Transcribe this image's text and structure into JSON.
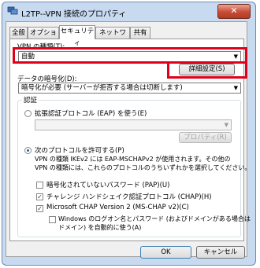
{
  "window": {
    "title": "L2TP--VPN 接続のプロパティ",
    "close_glyph": "✕"
  },
  "tabs": [
    {
      "label": "全般"
    },
    {
      "label": "オプション"
    },
    {
      "label": "セキュリティ"
    },
    {
      "label": "ネットワーク"
    },
    {
      "label": "共有"
    }
  ],
  "vpn_type": {
    "label": "VPN の種類(T):",
    "value": "自動"
  },
  "advanced_button": "詳細設定(S)",
  "encryption": {
    "label": "データの暗号化(D):",
    "value": "暗号化が必要 (サーバーが拒否する場合は切断します)"
  },
  "auth": {
    "group_label": "認証",
    "eap": {
      "label": "拡張認証プロトコル (EAP) を使う(E)",
      "properties_button": "プロパティ(R)"
    },
    "allow": {
      "label": "次のプロトコルを許可する(P)",
      "desc_line1": "VPN の種類 IKEv2 には EAP-MSCHAPv2 が使用されます。その他の",
      "desc_line2": "VPN の種類には、これらのプロトコルのうちいずれかを選択してください。"
    },
    "protocols": [
      {
        "label": "暗号化されていないパスワード (PAP)(U)",
        "checked": false
      },
      {
        "label": "チャレンジ ハンドシェイク認証プロトコル (CHAP)(H)",
        "checked": true
      },
      {
        "label": "Microsoft CHAP Version 2 (MS-CHAP v2)(C)",
        "checked": true
      }
    ],
    "windows_logon": {
      "line1": "Windows のログオン名とパスワード (およびドメインがある場合は",
      "line2": "ドメイン) を自動的に使う(A)",
      "checked": false
    }
  },
  "footer": {
    "ok": "OK",
    "cancel": "キャンセル"
  },
  "colors": {
    "highlight": "#e0001a"
  }
}
